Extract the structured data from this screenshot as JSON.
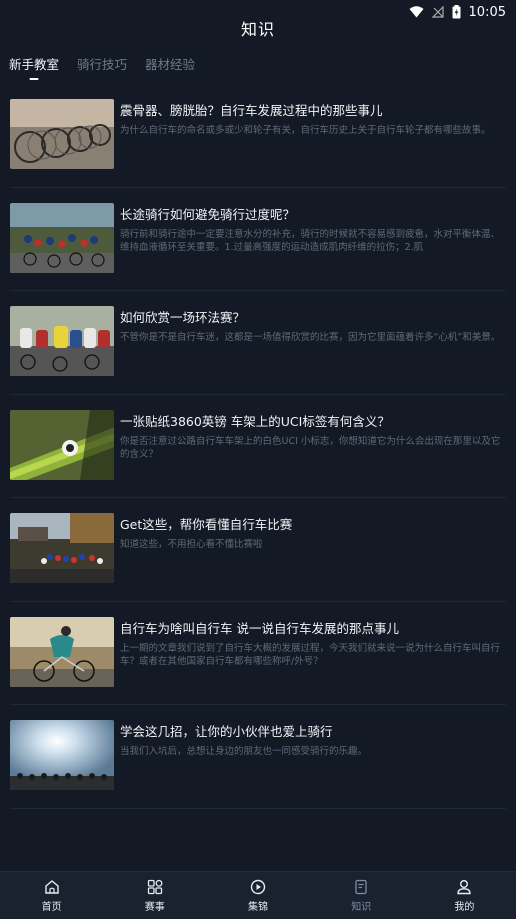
{
  "status": {
    "time": "10:05"
  },
  "header": {
    "title": "知识"
  },
  "tabs": [
    {
      "label": "新手教室",
      "active": true
    },
    {
      "label": "骑行技巧",
      "active": false
    },
    {
      "label": "器材经验",
      "active": false
    }
  ],
  "articles": [
    {
      "title": "震骨器、膀胱胎？自行车发展过程中的那些事儿",
      "desc": "为什么自行车的命名或多或少和轮子有关，自行车历史上关于自行车轮子都有哪些故事。"
    },
    {
      "title": "长途骑行如何避免骑行过度呢？",
      "desc": "骑行前和骑行途中一定要注意水分的补充，骑行的时候就不容易感到疲惫，水对平衡体温、维持血液循环至关重要。1.过量高强度的运动造成肌肉纤维的拉伤；2.肌"
    },
    {
      "title": "如何欣赏一场环法赛？",
      "desc": "不管你是不是自行车迷，这都是一场值得欣赏的比赛，因为它里面蕴着许多“心机”和美景。"
    },
    {
      "title": "一张贴纸3860英镑 车架上的UCI标签有何含义？",
      "desc": "你是否注意过公路自行车车架上的白色UCI 小标志，你想知道它为什么会出现在那里以及它的含义？"
    },
    {
      "title": "Get这些，帮你看懂自行车比赛",
      "desc": "知道这些，不用担心看不懂比赛啦"
    },
    {
      "title": "自行车为啥叫自行车 说一说自行车发展的那点事儿",
      "desc": "上一期的文章我们说到了自行车大概的发展过程，今天我们就来说一说为什么自行车叫自行车？或者在其他国家自行车都有哪些称呼/外号？"
    },
    {
      "title": "学会这几招，让你的小伙伴也爱上骑行",
      "desc": "当我们入坑后，总想让身边的朋友也一同感受骑行的乐趣。"
    }
  ],
  "bottom_nav": [
    {
      "label": "首页",
      "icon": "home-icon",
      "active": false
    },
    {
      "label": "赛事",
      "icon": "grid-icon",
      "active": false
    },
    {
      "label": "集锦",
      "icon": "play-icon",
      "active": false
    },
    {
      "label": "知识",
      "icon": "document-icon",
      "active": true
    },
    {
      "label": "我的",
      "icon": "user-icon",
      "active": false
    }
  ]
}
